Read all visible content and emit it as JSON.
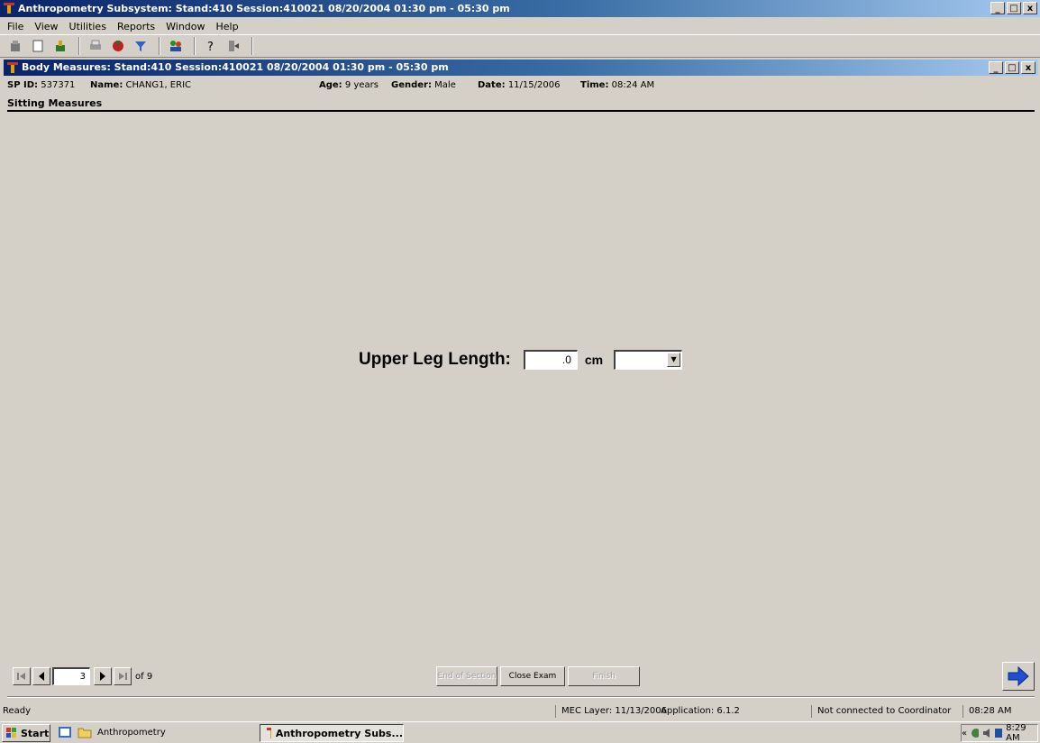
{
  "app": {
    "title": "Anthropometry Subsystem: Stand:410 Session:410021 08/20/2004 01:30 pm - 05:30 pm",
    "window_buttons": [
      "_",
      "□",
      "x"
    ]
  },
  "menu": [
    "File",
    "View",
    "Utilities",
    "Reports",
    "Window",
    "Help"
  ],
  "toolbar_icons": [
    "exam-icon",
    "new-icon",
    "tools-icon",
    "print-icon",
    "record-icon",
    "filter-icon",
    "people-icon",
    "help-icon",
    "exit-icon"
  ],
  "child": {
    "title": "Body Measures: Stand:410 Session:410021 08/20/2004 01:30 pm - 05:30 pm"
  },
  "info": {
    "sp_id_label": "SP ID:",
    "sp_id": "537371",
    "name_label": "Name:",
    "name": "CHANG1, ERIC",
    "age_label": "Age:",
    "age": "9 years",
    "gender_label": "Gender:",
    "gender": "Male",
    "date_label": "Date:",
    "date": "11/15/2006",
    "time_label": "Time:",
    "time": "08:24 AM"
  },
  "section_title": "Sitting Measures",
  "measure": {
    "label": "Upper Leg Length:",
    "value": ".0",
    "unit": "cm",
    "comment_selected": ""
  },
  "nav": {
    "page": "3",
    "of_pages": "of 9"
  },
  "actions": {
    "end_of_section": "End of Section",
    "close_exam": "Close Exam",
    "finish": "Finish"
  },
  "status": {
    "ready": "Ready",
    "mec_layer": "MEC Layer: 11/13/2006",
    "application": "Application: 6.1.2",
    "coordinator": "Not connected to Coordinator",
    "time": "08:28 AM"
  },
  "taskbar": {
    "start": "Start",
    "folder": "Anthropometry",
    "active_task": "Anthropometry Subs...",
    "clock": "8:29 AM",
    "tray_prefix": "«"
  },
  "colors": {
    "titlebar_start": "#0a246a",
    "titlebar_end": "#a6caf0",
    "face": "#d4d0c8",
    "next_arrow": "#1f4fd0"
  }
}
